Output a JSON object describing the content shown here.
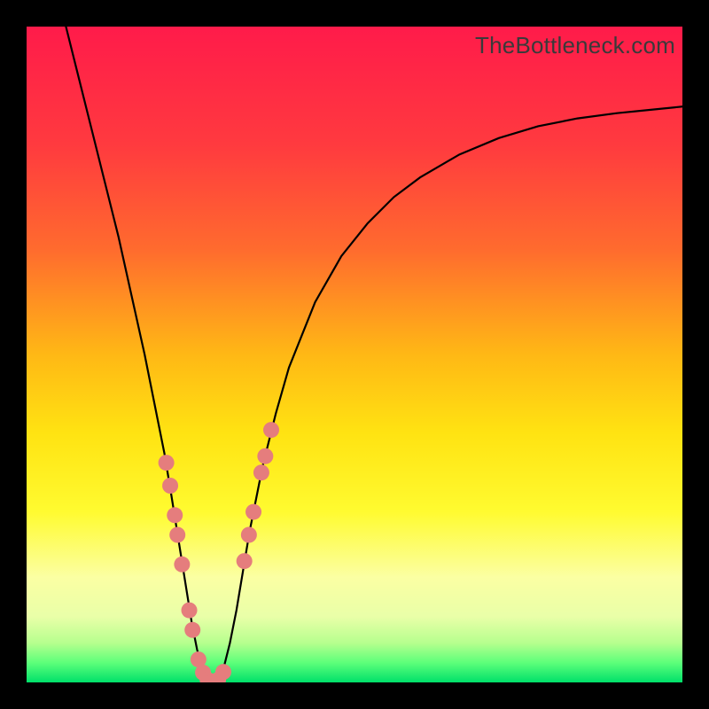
{
  "watermark": "TheBottleneck.com",
  "gradient_stops": [
    {
      "offset": 0.0,
      "color": "#ff1b4a"
    },
    {
      "offset": 0.18,
      "color": "#ff3a3f"
    },
    {
      "offset": 0.34,
      "color": "#ff6b2e"
    },
    {
      "offset": 0.5,
      "color": "#ffb815"
    },
    {
      "offset": 0.62,
      "color": "#ffe312"
    },
    {
      "offset": 0.74,
      "color": "#fffb30"
    },
    {
      "offset": 0.84,
      "color": "#fbffa3"
    },
    {
      "offset": 0.9,
      "color": "#e9ffa8"
    },
    {
      "offset": 0.94,
      "color": "#b6ff8e"
    },
    {
      "offset": 0.97,
      "color": "#5dff7a"
    },
    {
      "offset": 1.0,
      "color": "#00e06a"
    }
  ],
  "chart_data": {
    "type": "line",
    "title": "",
    "xlabel": "",
    "ylabel": "",
    "xlim": [
      0,
      100
    ],
    "ylim": [
      0,
      100
    ],
    "series": [
      {
        "name": "curve",
        "stroke": "#000000",
        "stroke_width": 2.2,
        "x": [
          6,
          8,
          10,
          12,
          14,
          16,
          18,
          19,
          20,
          21,
          22,
          22.8,
          23.6,
          24.4,
          25.2,
          26,
          26.8,
          27.6,
          28.4,
          29.2,
          30,
          31,
          32,
          33,
          34,
          36,
          38,
          40,
          44,
          48,
          52,
          56,
          60,
          66,
          72,
          78,
          84,
          90,
          96,
          100
        ],
        "y": [
          100,
          92,
          84,
          76,
          68,
          59,
          50,
          45,
          40,
          35,
          29,
          24,
          19,
          14,
          9,
          5,
          2,
          0.5,
          0,
          0.5,
          2,
          6,
          11,
          17,
          23,
          33,
          41,
          48,
          58,
          65,
          70,
          74,
          77,
          80.5,
          83,
          84.8,
          86,
          86.8,
          87.4,
          87.8
        ]
      }
    ],
    "markers": {
      "color": "#e57d7d",
      "radius": 9,
      "points": [
        {
          "x": 21.3,
          "y": 33.5
        },
        {
          "x": 21.9,
          "y": 30.0
        },
        {
          "x": 22.6,
          "y": 25.5
        },
        {
          "x": 23.0,
          "y": 22.5
        },
        {
          "x": 23.7,
          "y": 18.0
        },
        {
          "x": 24.8,
          "y": 11.0
        },
        {
          "x": 25.3,
          "y": 8.0
        },
        {
          "x": 26.2,
          "y": 3.5
        },
        {
          "x": 26.9,
          "y": 1.5
        },
        {
          "x": 27.6,
          "y": 0.4
        },
        {
          "x": 28.4,
          "y": 0.0
        },
        {
          "x": 29.2,
          "y": 0.4
        },
        {
          "x": 30.0,
          "y": 1.6
        },
        {
          "x": 33.2,
          "y": 18.5
        },
        {
          "x": 33.9,
          "y": 22.5
        },
        {
          "x": 34.6,
          "y": 26.0
        },
        {
          "x": 35.8,
          "y": 32.0
        },
        {
          "x": 36.4,
          "y": 34.5
        },
        {
          "x": 37.3,
          "y": 38.5
        }
      ]
    }
  }
}
